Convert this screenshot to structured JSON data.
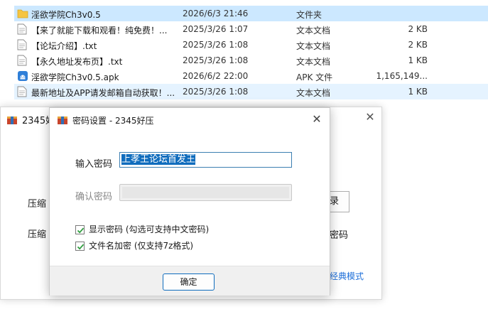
{
  "files": [
    {
      "name": "淫欲学院Ch3v0.5",
      "date": "2026/6/3 21:46",
      "type": "文件夹",
      "size": "",
      "icon": "folder-icon",
      "state": "selected"
    },
    {
      "name": "【来了就能下载和观看！纯免费！...",
      "date": "2025/3/26 1:07",
      "type": "文本文档",
      "size": "2 KB",
      "icon": "text-file-icon",
      "state": ""
    },
    {
      "name": "【论坛介绍】.txt",
      "date": "2025/3/26 1:08",
      "type": "文本文档",
      "size": "2 KB",
      "icon": "text-file-icon",
      "state": ""
    },
    {
      "name": "【永久地址发布页】.txt",
      "date": "2025/3/26 1:08",
      "type": "文本文档",
      "size": "1 KB",
      "icon": "text-file-icon",
      "state": ""
    },
    {
      "name": "淫欲学院Ch3v0.5.apk",
      "date": "2026/6/2 22:00",
      "type": "APK 文件",
      "size": "1,165,149...",
      "icon": "apk-file-icon",
      "state": ""
    },
    {
      "name": "最新地址及APP请发邮箱自动获取！...",
      "date": "2025/3/26 1:08",
      "type": "文本文档",
      "size": "1 KB",
      "icon": "text-file-icon",
      "state": "hover"
    }
  ],
  "back_window": {
    "title": "2345好",
    "label_1": "压缩",
    "label_2": "压缩",
    "button_fragment": "录",
    "mima_fragment": "密码",
    "link_fragment": "经典模式"
  },
  "dialog": {
    "title": "密码设置 - 2345好压",
    "password_label": "输入密码",
    "password_value": "上孝王论坛首发王",
    "confirm_label": "确认密码",
    "show_password_label": "显示密码 (勾选可支持中文密码)",
    "encrypt_filename_label": "文件名加密 (仅支持7z格式)",
    "ok_label": "确定"
  },
  "colors": {
    "selected_row": "#cce8ff",
    "hover_row": "#e5f3ff",
    "accent": "#0f6cbd",
    "link": "#1e6fd9",
    "check": "#2e9e3e"
  }
}
